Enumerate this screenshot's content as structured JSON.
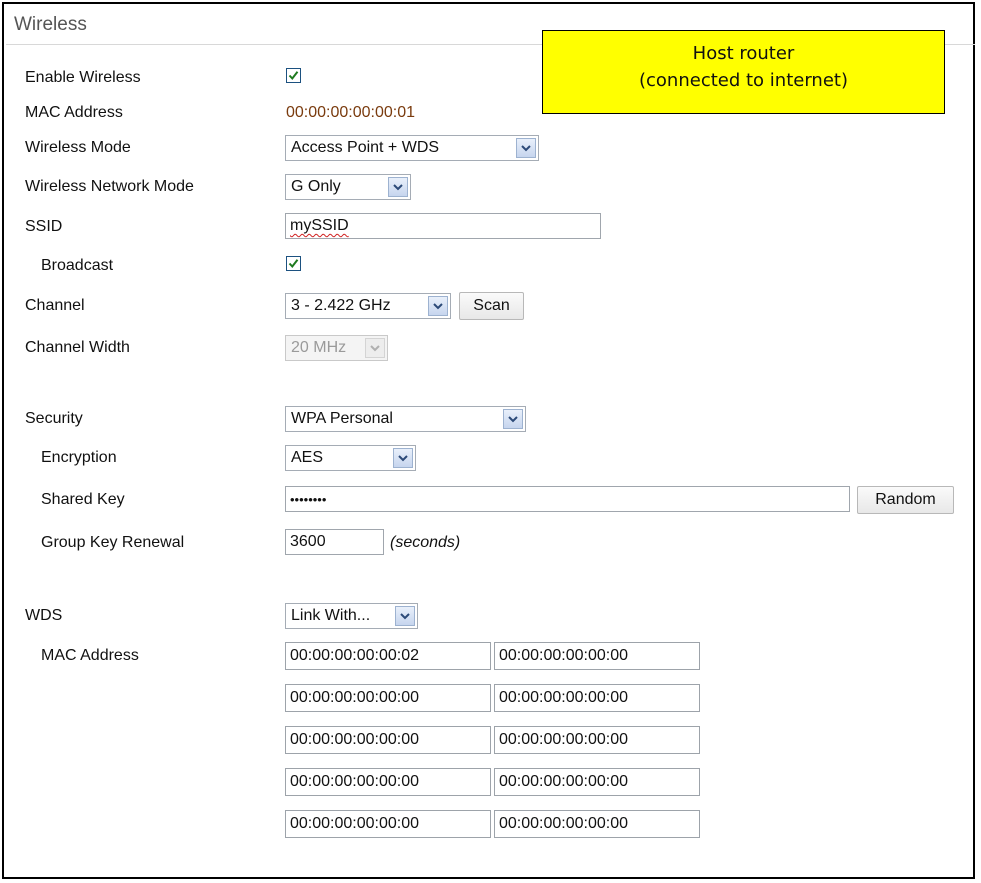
{
  "section": {
    "title": "Wireless"
  },
  "callout": {
    "line1": "Host router",
    "line2": "(connected to internet)"
  },
  "wireless": {
    "enable_label": "Enable Wireless",
    "mac_label": "MAC Address",
    "mac_value": "00:00:00:00:00:01",
    "mode_label": "Wireless Mode",
    "mode_value": "Access Point + WDS",
    "network_mode_label": "Wireless Network Mode",
    "network_mode_value": "G Only",
    "ssid_label": "SSID",
    "ssid_value": "mySSID",
    "broadcast_label": "Broadcast",
    "channel_label": "Channel",
    "channel_value": "3 - 2.422 GHz",
    "scan_label": "Scan",
    "channel_width_label": "Channel Width",
    "channel_width_value": "20 MHz"
  },
  "security": {
    "label": "Security",
    "value": "WPA Personal",
    "encryption_label": "Encryption",
    "encryption_value": "AES",
    "shared_key_label": "Shared Key",
    "shared_key_value": "••••••••",
    "random_label": "Random",
    "renewal_label": "Group Key Renewal",
    "renewal_value": "3600",
    "renewal_unit": "(seconds)"
  },
  "wds": {
    "label": "WDS",
    "value": "Link With...",
    "mac_label": "MAC Address",
    "macs": [
      "00:00:00:00:00:02",
      "00:00:00:00:00:00",
      "00:00:00:00:00:00",
      "00:00:00:00:00:00",
      "00:00:00:00:00:00",
      "00:00:00:00:00:00",
      "00:00:00:00:00:00",
      "00:00:00:00:00:00",
      "00:00:00:00:00:00",
      "00:00:00:00:00:00"
    ]
  },
  "icons": {
    "checkbox_checked": "checkmark-icon",
    "dropdown": "chevron-down-icon"
  },
  "colors": {
    "callout_bg": "#ffff00",
    "mac_value": "#7a3b0e",
    "check": "#1e7a1e"
  }
}
